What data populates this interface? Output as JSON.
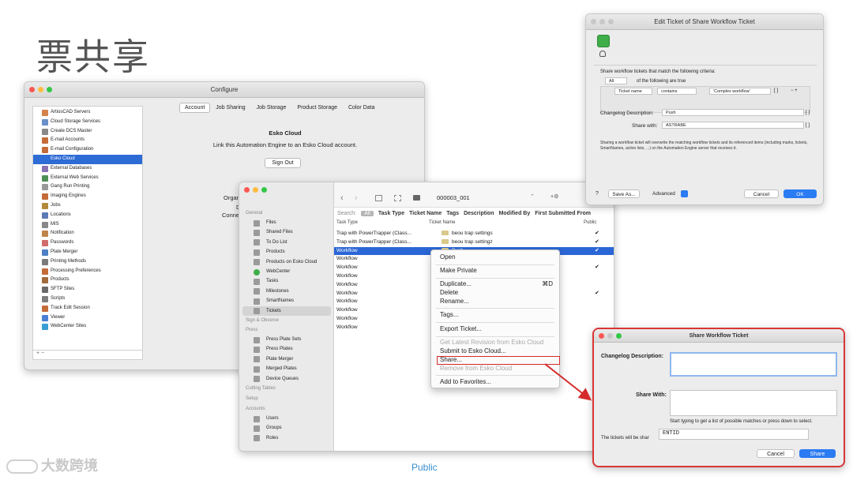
{
  "slide": {
    "title": "票共享",
    "footer": "Public",
    "watermark": "大数跨境"
  },
  "configure": {
    "title": "Configure",
    "sidebar": [
      "ArtiosCAD Servers",
      "Cloud Storage Services",
      "Create DCS Master",
      "E-mail Accounts",
      "E-mail Configuration",
      "Esko Cloud",
      "External Databases",
      "External Web Services",
      "Gang Run Printing",
      "Imaging Engines",
      "Jobs",
      "Locations",
      "MIS",
      "Notification",
      "Passwords",
      "Plate Merger",
      "Printing Methods",
      "Processing Preferences",
      "Products",
      "SFTP Sites",
      "Scripts",
      "Track Edit Session",
      "Viewer",
      "WebCenter Sites"
    ],
    "selected_index": 5,
    "bottom_controls": "+  −",
    "tabs": [
      "Account",
      "Job Sharing",
      "Job Storage",
      "Product Storage",
      "Color Data"
    ],
    "content_title": "Esko Cloud",
    "content_text": "Link this Automation Engine to an Esko Cloud account.",
    "signout_label": "Sign Out",
    "fragments": [
      "Organ",
      "D",
      "Conne"
    ]
  },
  "engine": {
    "sidebar_sections": {
      "general": "General",
      "sign": "Sign & Observe",
      "press": "Press",
      "cutting": "Cutting Tables",
      "setup": "Setup",
      "accounts": "Accounts"
    },
    "general_items": [
      "Files",
      "Shared Files",
      "To Do List",
      "Products",
      "Products on Esko Cloud",
      "WebCenter",
      "Tasks",
      "Milestones",
      "SmartNames",
      "Tickets"
    ],
    "press_items": [
      "Press Plate Sets",
      "Press Plates",
      "Plate Merger",
      "Merged Plates",
      "Device Queues"
    ],
    "account_items": [
      "Users",
      "Groups",
      "Roles"
    ],
    "toolbar": {
      "back": "‹",
      "forward": "›",
      "job": "000003_001",
      "stepper": "⌃",
      "more": "+⚙"
    },
    "filter": {
      "search": "Search:",
      "all": "All",
      "fields": [
        "Task Type",
        "Ticket Name",
        "Tags",
        "Description",
        "Modified By",
        "First Submitted From"
      ]
    },
    "columns": {
      "task_type": "Task Type",
      "ticket_name": "Ticket Name",
      "public": "Public"
    },
    "rows": [
      {
        "task_type": "Trap with PowerTrapper (Class...",
        "ticket_name": "beou trap settings",
        "public": "✔"
      },
      {
        "task_type": "Trap with PowerTrapper (Class...",
        "ticket_name": "beou trap settingz",
        "public": "✔"
      },
      {
        "task_type": "Workflow",
        "ticket_name": "Push",
        "public": "✔"
      },
      {
        "task_type": "Workflow",
        "ticket_name": "",
        "public": ""
      },
      {
        "task_type": "Workflow",
        "ticket_name": "",
        "public": "✔"
      },
      {
        "task_type": "Workflow",
        "ticket_name": "",
        "public": ""
      },
      {
        "task_type": "Workflow",
        "ticket_name": "",
        "public": ""
      },
      {
        "task_type": "Workflow",
        "ticket_name": "",
        "public": "✔"
      },
      {
        "task_type": "Workflow",
        "ticket_name": "",
        "public": ""
      },
      {
        "task_type": "Workflow",
        "ticket_name": "",
        "public": ""
      },
      {
        "task_type": "Workflow",
        "ticket_name": "",
        "public": ""
      },
      {
        "task_type": "Workflow",
        "ticket_name": "",
        "public": ""
      }
    ],
    "selected_row": 2
  },
  "context_menu": {
    "open": "Open",
    "make_private": "Make Private",
    "duplicate": "Duplicate...",
    "duplicate_shortcut": "⌘D",
    "delete": "Delete",
    "rename": "Rename...",
    "tags": "Tags...",
    "export": "Export Ticket...",
    "get_latest": "Get Latest Revision from Esko Cloud",
    "submit": "Submit to Esko Cloud...",
    "share": "Share...",
    "remove": "Remove from Esko Cloud",
    "favorites": "Add to Favorites..."
  },
  "edit_ticket": {
    "title": "Edit Ticket of Share Workflow Ticket",
    "criteria_label": "Share workflow tickets that match the following criteria:",
    "quantifier": "All",
    "quantifier_suffix": "of the following are true",
    "field": "Ticket name",
    "operator": "contains",
    "value": "'Complex workflow'",
    "plus_minus": "−  +",
    "changelog_label": "Changelog Description:",
    "changelog_value": "Push",
    "share_with_label": "Share with:",
    "share_with_value": "ASTRABE",
    "brackets": "[ ]",
    "note": "Sharing a workflow ticket will overwrite the matching workflow tickets and its referenced items (including marks, tickets, SmartNames, action lists, ...) on the Automation Engine server that receives it.",
    "help": "?",
    "save_as": "Save As...",
    "advanced": "Advanced",
    "cancel": "Cancel",
    "ok": "OK"
  },
  "share_dialog": {
    "title": "Share Workflow Ticket",
    "changelog_label": "Changelog Description:",
    "share_with_label": "Share With:",
    "hint": "Start typing to get a list of possible matches or press down to select.",
    "tickets_label": "The tickets will be shar",
    "share_value": "ENTID",
    "cancel": "Cancel",
    "share": "Share"
  },
  "colors": {
    "accent": "#2b7bf2",
    "selection": "#2b66d6",
    "highlight": "#d42a2a"
  }
}
